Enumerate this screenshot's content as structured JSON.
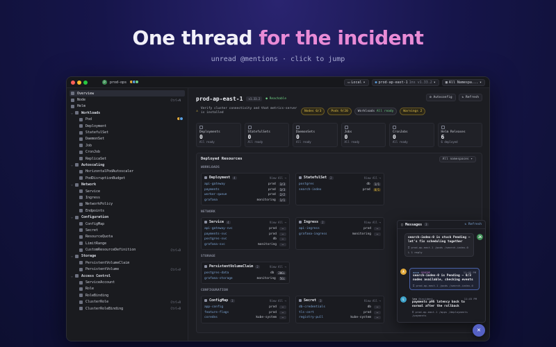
{
  "hero": {
    "title_part1": "One thread ",
    "title_part2": "for the incident",
    "subtitle": "unread @mentions · click to jump"
  },
  "colors": {
    "accent": "#e98bd6",
    "ok": "#6fcf84",
    "warn": "#e6c34a",
    "link": "#7fa8d8",
    "fab": "#5561c4"
  },
  "titlebar": {
    "context": "prod-ops",
    "context_badge": "P",
    "local_label": "Local",
    "cluster_label": "prod-ap-east-1",
    "cluster_ver": "1ns v1.33.2",
    "ns_label": "All Namespa..."
  },
  "sidebar": {
    "items": [
      {
        "label": "Overview",
        "type": "top",
        "active": true
      },
      {
        "label": "Node",
        "type": "top",
        "kbd": "Ctrl+N"
      },
      {
        "label": "Helm",
        "type": "top"
      },
      {
        "label": "Workloads",
        "type": "section"
      },
      {
        "label": "Pod",
        "type": "child"
      },
      {
        "label": "Deployment",
        "type": "child"
      },
      {
        "label": "StatefulSet",
        "type": "child"
      },
      {
        "label": "DaemonSet",
        "type": "child"
      },
      {
        "label": "Job",
        "type": "child"
      },
      {
        "label": "CronJob",
        "type": "child"
      },
      {
        "label": "ReplicaSet",
        "type": "child"
      },
      {
        "label": "Autoscaling",
        "type": "section"
      },
      {
        "label": "HorizontalPodAutoscaler",
        "type": "child"
      },
      {
        "label": "PodDisruptionBudget",
        "type": "child"
      },
      {
        "label": "Network",
        "type": "section"
      },
      {
        "label": "Service",
        "type": "child"
      },
      {
        "label": "Ingress",
        "type": "child"
      },
      {
        "label": "NetworkPolicy",
        "type": "child"
      },
      {
        "label": "Endpoints",
        "type": "child"
      },
      {
        "label": "Configuration",
        "type": "section"
      },
      {
        "label": "ConfigMap",
        "type": "child"
      },
      {
        "label": "Secret",
        "type": "child"
      },
      {
        "label": "ResourceQuota",
        "type": "child"
      },
      {
        "label": "LimitRange",
        "type": "child"
      },
      {
        "label": "CustomResourceDefinition",
        "type": "child",
        "kbd": "Ctrl+D"
      },
      {
        "label": "Storage",
        "type": "section"
      },
      {
        "label": "PersistentVolumeClaim",
        "type": "child"
      },
      {
        "label": "PersistentVolume",
        "type": "child",
        "kbd": "Ctrl+V"
      },
      {
        "label": "Access Control",
        "type": "section"
      },
      {
        "label": "ServiceAccount",
        "type": "child"
      },
      {
        "label": "Role",
        "type": "child"
      },
      {
        "label": "RoleBinding",
        "type": "child"
      },
      {
        "label": "ClusterRole",
        "type": "child",
        "kbd": "Ctrl+R"
      },
      {
        "label": "ClusterRoleBinding",
        "type": "child",
        "kbd": "Ctrl+B"
      }
    ]
  },
  "main": {
    "cluster_name": "prod-ap-east-1",
    "version": "v1.33.2",
    "reachable": "Reachable",
    "autoconfig": "Autoconfig",
    "refresh": "Refresh",
    "status_msg": "Verify cluster connectivity and that metrics-server is installed",
    "pills": {
      "nodes": "Nodes 0/3",
      "pods": "Pods 9/20",
      "workloads_label": "Workloads",
      "workloads_val": "All ready",
      "warnings": "Warnings 2"
    },
    "cards": [
      {
        "label": "Deployments",
        "value": "0",
        "sub": "All ready"
      },
      {
        "label": "StatefulSets",
        "value": "0",
        "sub": "All ready"
      },
      {
        "label": "DaemonSets",
        "value": "0",
        "sub": "All ready"
      },
      {
        "label": "Jobs",
        "value": "0",
        "sub": "All ready"
      },
      {
        "label": "CronJobs",
        "value": "0",
        "sub": "All ready"
      },
      {
        "label": "Helm Releases",
        "value": "6",
        "sub": "6 deployed"
      }
    ],
    "deployed_title": "Deployed Resources",
    "ns_select": "All namespaces",
    "groups": {
      "workloads": "WORKLOADS",
      "network": "NETWORK",
      "storage": "STORAGE",
      "configuration": "CONFIGURATION"
    },
    "view_all": "View All →",
    "deployment": {
      "title": "Deployment",
      "count": "4",
      "rows": [
        {
          "name": "api-gateway",
          "ns": "prod",
          "status": "3/3"
        },
        {
          "name": "payments",
          "ns": "prod",
          "status": "3/3"
        },
        {
          "name": "worker-queue",
          "ns": "prod",
          "status": "2/2"
        },
        {
          "name": "grafana",
          "ns": "monitoring",
          "status": "1/1"
        }
      ]
    },
    "statefulset": {
      "title": "StatefulSet",
      "count": "2",
      "rows": [
        {
          "name": "postgres",
          "ns": "db",
          "status": "1/1"
        },
        {
          "name": "search-index",
          "ns": "prod",
          "status": "0/1",
          "warn": true
        }
      ]
    },
    "service": {
      "title": "Service",
      "count": "4",
      "rows": [
        {
          "name": "api-gateway-svc",
          "ns": "prod",
          "status": "—"
        },
        {
          "name": "payments-svc",
          "ns": "prod",
          "status": "—"
        },
        {
          "name": "postgres-svc",
          "ns": "db",
          "status": "—"
        },
        {
          "name": "grafana-svc",
          "ns": "monitoring",
          "status": "—"
        }
      ]
    },
    "ingress": {
      "title": "Ingress",
      "count": "2",
      "rows": [
        {
          "name": "api-ingress",
          "ns": "prod",
          "status": "—"
        },
        {
          "name": "grafana-ingress",
          "ns": "monitoring",
          "status": "—"
        }
      ]
    },
    "pvc": {
      "title": "PersistentVolumeClaim",
      "count": "2",
      "rows": [
        {
          "name": "postgres-data",
          "ns": "db",
          "status": "20Gi"
        },
        {
          "name": "grafana-storage",
          "ns": "monitoring",
          "status": "5Gi"
        }
      ]
    },
    "configmap": {
      "title": "ConfigMap",
      "count": "3",
      "rows": [
        {
          "name": "app-config",
          "ns": "prod",
          "status": "—"
        },
        {
          "name": "feature-flags",
          "ns": "prod",
          "status": "—"
        },
        {
          "name": "coredns",
          "ns": "kube-system",
          "status": "—"
        }
      ]
    },
    "secret": {
      "title": "Secret",
      "count": "3",
      "rows": [
        {
          "name": "db-credentials",
          "ns": "db",
          "status": "—"
        },
        {
          "name": "tls-cert",
          "ns": "prod",
          "status": "—"
        },
        {
          "name": "registry-pull",
          "ns": "kube-system",
          "status": "—"
        }
      ]
    }
  },
  "chat": {
    "title": "Messages",
    "count": "3",
    "refresh": "Refresh",
    "messages": [
      {
        "text": "search-index-0 is stuck Pending — let's fix scheduling together",
        "ctx": "prod-ap-east-1 /pods /search-index-0",
        "sub": "1 reply",
        "avatar": "JK"
      },
      {
        "author": "aana",
        "tag": "SEVERE",
        "time": "11:45 PM",
        "text": "search-index-0 is Pending — 0/3 nodes available, checking events",
        "ctx": "prod-ap-east-1 /pods /search-index-0",
        "avatar": "A"
      },
      {
        "author": "leo",
        "tag": "@incident",
        "time": "11:45 PM",
        "text": "payments p95 latency back to normal after the rollback",
        "ctx": "prod-ap-east-1 /apps /deployments /payments",
        "avatar": "L"
      }
    ]
  },
  "fab_icon": "✕"
}
